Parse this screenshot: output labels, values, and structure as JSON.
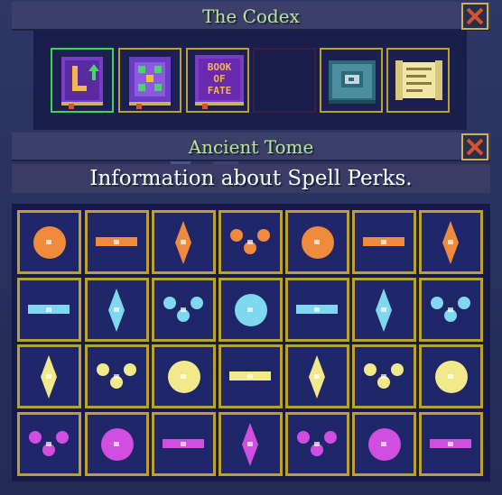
{
  "codex": {
    "title": "The Codex",
    "books": [
      {
        "name": "book-icon",
        "selected": true
      },
      {
        "name": "rune-grid-book-icon",
        "selected": false
      },
      {
        "name": "book-of-fate-icon",
        "cover_text": [
          "BOOK",
          "OF",
          "FATE"
        ],
        "selected": false
      },
      {
        "name": "empty-slot",
        "selected": false
      },
      {
        "name": "stone-tome-icon",
        "selected": false
      },
      {
        "name": "scroll-icon",
        "selected": false
      }
    ]
  },
  "tome": {
    "title": "Ancient Tome",
    "info": "Information about Spell Perks."
  },
  "spell_rows": [
    {
      "element": "fire",
      "color": "#f08a3c",
      "icons": [
        "fire-swirl-icon",
        "fireballs-icon",
        "fire-pillar-icon",
        "fire-beam-icon",
        "fire-wisp-icon",
        "volcano-icon",
        "fire-golem-icon"
      ]
    },
    {
      "element": "ice",
      "color": "#7fd7f0",
      "icons": [
        "ice-boulder-icon",
        "ice-shard-icon",
        "ice-crystals-icon",
        "ice-beam-icon",
        "ice-fish-icon",
        "ice-shield-icon",
        "ice-golem-icon"
      ]
    },
    {
      "element": "light",
      "color": "#f2e98a",
      "icons": [
        "light-chain-icon",
        "light-sword-icon",
        "light-sparks-icon",
        "light-stars-icon",
        "light-orb-icon",
        "light-beam-icon",
        "light-golem-icon"
      ]
    },
    {
      "element": "arcane",
      "color": "#d04ee0",
      "icons": [
        "arcane-bolts-icon",
        "arcane-dash-icon",
        "arcane-blob-icon",
        "arcane-drip-icon",
        "arcane-arc-icon",
        "arcane-spark-icon",
        "arcane-spirit-icon"
      ]
    }
  ],
  "colors": {
    "title_green": "#b7e58e",
    "frame_gold": "#b9a12e",
    "selected_green": "#3ed35a",
    "close_red": "#d6542c"
  }
}
